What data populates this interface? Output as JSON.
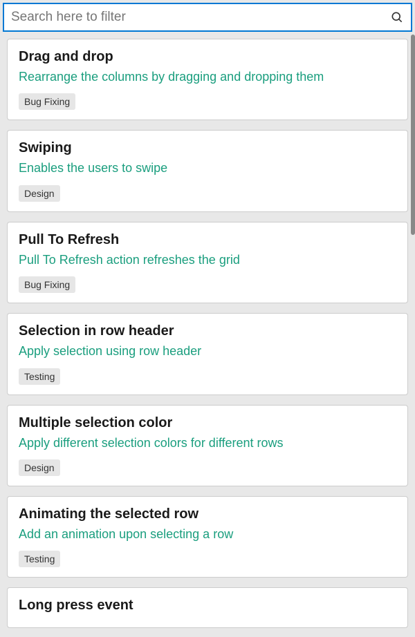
{
  "search": {
    "placeholder": "Search here to filter",
    "value": ""
  },
  "items": [
    {
      "title": "Drag and drop",
      "description": "Rearrange the columns by dragging and dropping them",
      "tag": "Bug Fixing"
    },
    {
      "title": "Swiping",
      "description": "Enables the users to swipe",
      "tag": "Design"
    },
    {
      "title": "Pull To Refresh",
      "description": "Pull To Refresh action refreshes the grid",
      "tag": "Bug Fixing"
    },
    {
      "title": "Selection in row header",
      "description": "Apply selection using row header",
      "tag": "Testing"
    },
    {
      "title": "Multiple selection color",
      "description": "Apply different selection colors for different rows",
      "tag": "Design"
    },
    {
      "title": "Animating the selected row",
      "description": "Add an animation upon selecting a row",
      "tag": "Testing"
    },
    {
      "title": "Long press event",
      "description": "",
      "tag": ""
    }
  ]
}
